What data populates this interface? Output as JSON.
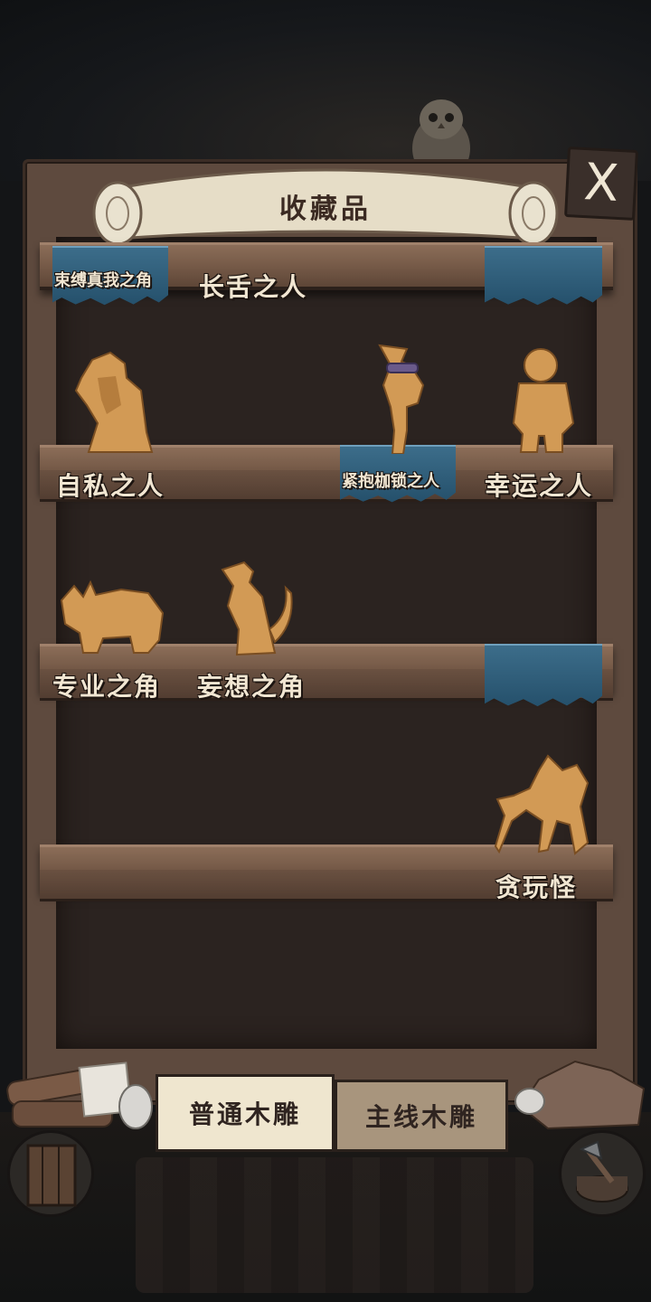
{
  "header": {
    "title": "收藏品",
    "close_label": "X"
  },
  "shelves": [
    {
      "items": [
        {
          "label": "束缚真我之角",
          "highlight": true
        },
        {
          "label": "长舌之人",
          "highlight": false
        },
        {
          "label": "",
          "highlight": true
        }
      ]
    },
    {
      "items": [
        {
          "label": "自私之人",
          "highlight": false
        },
        {
          "label": "紧抱枷锁之人",
          "highlight": true
        },
        {
          "label": "幸运之人",
          "highlight": false
        }
      ]
    },
    {
      "items": [
        {
          "label": "专业之角",
          "highlight": false
        },
        {
          "label": "妄想之角",
          "highlight": false
        },
        {
          "label": "",
          "highlight": true
        }
      ]
    },
    {
      "items": [
        {
          "label": "贪玩怪",
          "highlight": false
        }
      ]
    }
  ],
  "tabs": [
    {
      "label": "普通木雕",
      "active": true
    },
    {
      "label": "主线木雕",
      "active": false
    }
  ],
  "colors": {
    "wood": "#5e4a3e",
    "shelf": "#7a5e4b",
    "highlight_cloth": "#2f5d79",
    "carving": "#d29a55",
    "label_text": "#f1e6d2",
    "tab_active": "#efe6cf",
    "tab_inactive": "#a8957d"
  }
}
